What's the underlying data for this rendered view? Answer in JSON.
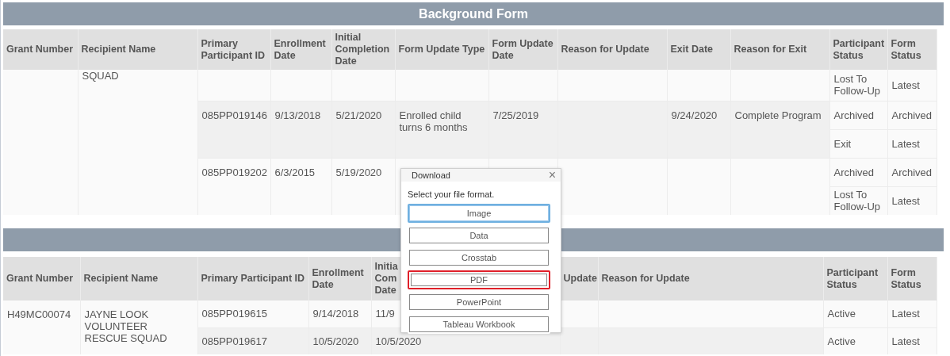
{
  "panels": [
    {
      "title": "Background Form",
      "columns": [
        "Grant Number",
        "Recipient Name",
        "Primary Participant ID",
        "Enrollment Date",
        "Initial Completion Date",
        "Form Update Type",
        "Form Update Date",
        "Reason for Update",
        "Exit Date",
        "Reason for Exit",
        "Participant Status",
        "Form Status"
      ],
      "groups": [
        {
          "recipient": "SQUAD",
          "participants": [
            {
              "cells": [
                "",
                "",
                "",
                "",
                "",
                "",
                "",
                ""
              ],
              "statuses": [
                {
                  "participant": "Lost To Follow-Up",
                  "form": "Latest"
                }
              ]
            },
            {
              "cells": [
                "085PP019146",
                "9/13/2018",
                "5/21/2020",
                "Enrolled child turns 6 months",
                "7/25/2019",
                "",
                "9/24/2020",
                "Complete Program"
              ],
              "statuses": [
                {
                  "participant": "Archived",
                  "form": "Archived"
                },
                {
                  "participant": "Exit",
                  "form": "Latest"
                }
              ]
            },
            {
              "cells": [
                "085PP019202",
                "6/3/2015",
                "5/19/2020",
                "",
                "",
                "",
                "",
                ""
              ],
              "statuses": [
                {
                  "participant": "Archived",
                  "form": "Archived"
                },
                {
                  "participant": "Lost To Follow-Up",
                  "form": "Latest"
                }
              ]
            }
          ]
        }
      ]
    },
    {
      "columns": [
        "Grant Number",
        "Recipient Name",
        "Primary Participant ID",
        "Enrollment Date",
        "Initia Com Date",
        "Update",
        "Reason for Update",
        "Participant Status",
        "Form Status"
      ],
      "groups": [
        {
          "grant": "H49MC00074",
          "recipient": "JAYNE LOOK VOLUNTEER RESCUE SQUAD",
          "participants": [
            {
              "cells": [
                "085PP019615",
                "9/14/2018",
                "11/9",
                "",
                ""
              ],
              "statuses": [
                {
                  "participant": "Active",
                  "form": "Latest"
                }
              ]
            },
            {
              "cells": [
                "085PP019617",
                "10/5/2020",
                "10/5/2020",
                "",
                ""
              ],
              "statuses": [
                {
                  "participant": "Active",
                  "form": "Latest"
                }
              ]
            }
          ]
        }
      ]
    }
  ],
  "dialog": {
    "title": "Download",
    "close": "×",
    "prompt": "Select your file format.",
    "options": [
      {
        "label": "Image",
        "focused": true,
        "highlighted": false
      },
      {
        "label": "Data",
        "focused": false,
        "highlighted": false
      },
      {
        "label": "Crosstab",
        "focused": false,
        "highlighted": false
      },
      {
        "label": "PDF",
        "focused": false,
        "highlighted": true
      },
      {
        "label": "PowerPoint",
        "focused": false,
        "highlighted": false
      },
      {
        "label": "Tableau Workbook",
        "focused": false,
        "highlighted": false
      }
    ]
  }
}
